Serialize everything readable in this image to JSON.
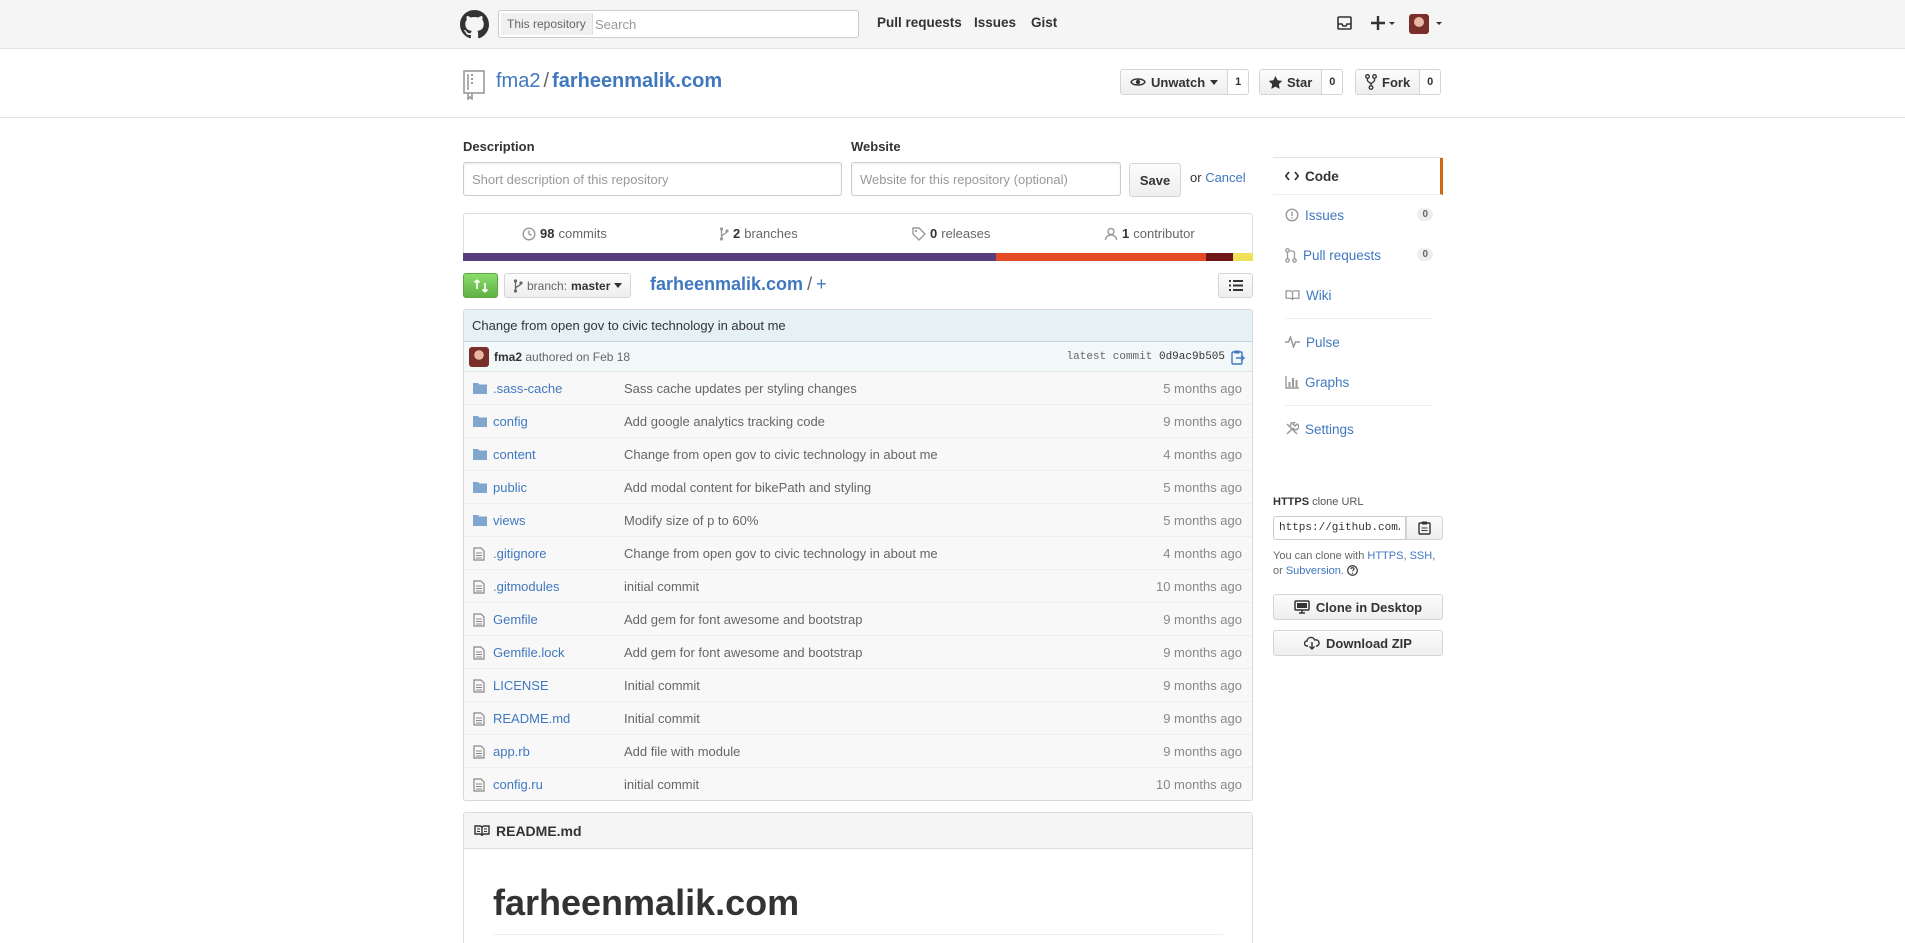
{
  "header": {
    "search_scope": "This repository",
    "search_placeholder": "Search",
    "nav": [
      "Pull requests",
      "Issues",
      "Gist"
    ]
  },
  "repo": {
    "owner": "fma2",
    "separator": "/",
    "name": "farheenmalik.com",
    "actions": {
      "watch_label": "Unwatch",
      "watch_count": "1",
      "star_label": "Star",
      "star_count": "0",
      "fork_label": "Fork",
      "fork_count": "0"
    }
  },
  "edit_form": {
    "description_label": "Description",
    "description_placeholder": "Short description of this repository",
    "website_label": "Website",
    "website_placeholder": "Website for this repository (optional)",
    "save_label": "Save",
    "or_text": "or",
    "cancel_label": "Cancel"
  },
  "summary": {
    "commits_count": "98",
    "commits_label": "commits",
    "branches_count": "2",
    "branches_label": "branches",
    "releases_count": "0",
    "releases_label": "releases",
    "contributors_count": "1",
    "contributor_label": "contributor"
  },
  "language_bar": [
    {
      "color": "#563d7c",
      "percent": 67.5
    },
    {
      "color": "#e34c26",
      "percent": 26.5
    },
    {
      "color": "#701516",
      "percent": 3.5
    },
    {
      "color": "#f1e05a",
      "percent": 2.5
    }
  ],
  "file_nav": {
    "branch_prefix": "branch:",
    "branch_name": "master",
    "root": "farheenmalik.com",
    "separator": "/",
    "add": "+"
  },
  "commit": {
    "message": "Change from open gov to civic technology in about me",
    "author": "fma2",
    "authored": "authored on Feb 18",
    "latest_label": "latest commit",
    "sha": "0d9ac9b505"
  },
  "files": [
    {
      "type": "dir",
      "name": ".sass-cache",
      "message": "Sass cache updates per styling changes",
      "age": "5 months ago"
    },
    {
      "type": "dir",
      "name": "config",
      "message": "Add google analytics tracking code",
      "age": "9 months ago"
    },
    {
      "type": "dir",
      "name": "content",
      "message": "Change from open gov to civic technology in about me",
      "age": "4 months ago"
    },
    {
      "type": "dir",
      "name": "public",
      "message": "Add modal content for bikePath and styling",
      "age": "5 months ago"
    },
    {
      "type": "dir",
      "name": "views",
      "message": "Modify size of p to 60%",
      "age": "5 months ago"
    },
    {
      "type": "file",
      "name": ".gitignore",
      "message": "Change from open gov to civic technology in about me",
      "age": "4 months ago"
    },
    {
      "type": "file",
      "name": ".gitmodules",
      "message": "initial commit",
      "age": "10 months ago"
    },
    {
      "type": "file",
      "name": "Gemfile",
      "message": "Add gem for font awesome and bootstrap",
      "age": "9 months ago"
    },
    {
      "type": "file",
      "name": "Gemfile.lock",
      "message": "Add gem for font awesome and bootstrap",
      "age": "9 months ago"
    },
    {
      "type": "file",
      "name": "LICENSE",
      "message": "Initial commit",
      "age": "9 months ago"
    },
    {
      "type": "file",
      "name": "README.md",
      "message": "Initial commit",
      "age": "9 months ago"
    },
    {
      "type": "file",
      "name": "app.rb",
      "message": "Add file with module",
      "age": "9 months ago"
    },
    {
      "type": "file",
      "name": "config.ru",
      "message": "initial commit",
      "age": "10 months ago"
    }
  ],
  "readme": {
    "filename": "README.md",
    "heading": "farheenmalik.com"
  },
  "sidebar": {
    "code_label": "Code",
    "issues_label": "Issues",
    "issues_count": "0",
    "pulls_label": "Pull requests",
    "pulls_count": "0",
    "wiki_label": "Wiki",
    "pulse_label": "Pulse",
    "graphs_label": "Graphs",
    "settings_label": "Settings",
    "clone_protocol": "HTTPS",
    "clone_label": "clone URL",
    "clone_url": "https://github.com/f",
    "clone_help_prefix": "You can clone with",
    "clone_https": "HTTPS",
    "clone_ssh": "SSH",
    "clone_or": "or",
    "clone_svn": "Subversion",
    "clone_desktop_label": "Clone in Desktop",
    "download_zip_label": "Download ZIP"
  },
  "colors": {
    "link": "#4078c0",
    "accent_selected": "#d26911",
    "compare_green": "#60b044",
    "commit_bg": "#e6f1f6"
  }
}
